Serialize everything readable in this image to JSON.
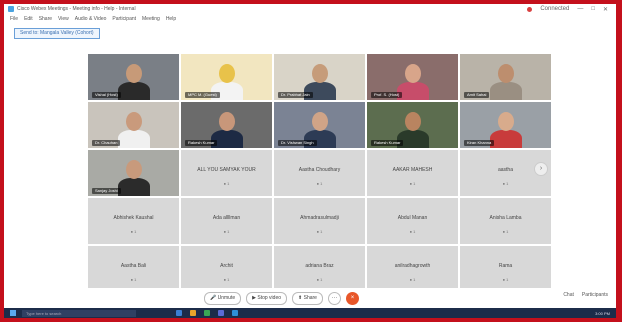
{
  "window": {
    "title": "Cisco Webex Meetings - Meeting info - Help - Internal",
    "user_label": "Connected"
  },
  "menu": [
    "File",
    "Edit",
    "Share",
    "View",
    "Audio & Video",
    "Participant",
    "Meeting",
    "Help"
  ],
  "tab": {
    "label": "Send to: Mangala Valley (Cohort)"
  },
  "video_tiles": [
    {
      "label": "Vishal (Host)",
      "bg": "#7a7f86",
      "skin": "#c79a78",
      "shirt": "#2a2a2a"
    },
    {
      "label": "MPC M. (Guest)",
      "bg": "#f2e6c0",
      "skin": "#e8c24a",
      "shirt": "#f3f3f3"
    },
    {
      "label": "Dr. Prabhat Jain",
      "bg": "#d9d4c8",
      "skin": "#c69c7a",
      "shirt": "#3d4a5c"
    },
    {
      "label": "Prof. S. (Host)",
      "bg": "#8a6d6b",
      "skin": "#d8a58a",
      "shirt": "#c74d6a"
    },
    {
      "label": "Amit Sahai",
      "bg": "#b9b3a8",
      "skin": "#bd8e6e",
      "shirt": "#9a8f82"
    },
    {
      "label": "Dr. Chauhan",
      "bg": "#c9c4bc",
      "skin": "#c99a7c",
      "shirt": "#f0f0f0"
    },
    {
      "label": "Rakesh Kumar",
      "bg": "#6b6b6b",
      "skin": "#c8977a",
      "shirt": "#1d2a44"
    },
    {
      "label": "Dr. Vishwan Singh",
      "bg": "#7b8394",
      "skin": "#d0a487",
      "shirt": "#2d3b55"
    },
    {
      "label": "Rakesh Kumar",
      "bg": "#5c6d4f",
      "skin": "#b98460",
      "shirt": "#2a3a2a"
    },
    {
      "label": "Kiran Khanna",
      "bg": "#9aa0a6",
      "skin": "#d8ab8c",
      "shirt": "#c83b3b"
    },
    {
      "label": "Sanjay Joshi",
      "bg": "#a9aaa5",
      "skin": "#c89a7c",
      "shirt": "#2b2b2b"
    }
  ],
  "participant_tiles": [
    {
      "name": "ALL YOU SAMYAK YOUR",
      "sub": "● 1"
    },
    {
      "name": "Aastha Choudhary",
      "sub": "● 1"
    },
    {
      "name": "AAKAR MAHESH",
      "sub": "● 1"
    },
    {
      "name": "aastha",
      "sub": "● 1"
    },
    {
      "name": "Abhishek Kaushal",
      "sub": "● 1"
    },
    {
      "name": "Ada allllman",
      "sub": "● 1"
    },
    {
      "name": "Ahmadrasulmadji",
      "sub": "● 1"
    },
    {
      "name": "Abdul Manan",
      "sub": "● 1"
    },
    {
      "name": "Anisha Lamba",
      "sub": "● 1"
    },
    {
      "name": "Aastha Bali",
      "sub": "● 1"
    },
    {
      "name": "Archit",
      "sub": "● 1"
    },
    {
      "name": "adriana Braz",
      "sub": "● 1"
    },
    {
      "name": "anilradhagrowth",
      "sub": "● 1"
    },
    {
      "name": "Rama",
      "sub": "● 1"
    }
  ],
  "toolbar": {
    "mute": "Unmute",
    "video": "Stop video",
    "share": "Share",
    "more": "···",
    "leave": "×",
    "chat": "Chat",
    "participants": "Participants"
  },
  "taskbar": {
    "search_placeholder": "Type here to search",
    "time": "3:00 PM"
  }
}
